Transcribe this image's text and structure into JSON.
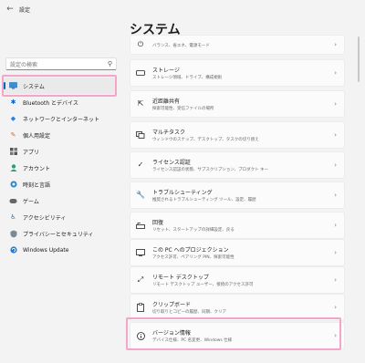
{
  "app": {
    "title": "設定",
    "page_title": "システム"
  },
  "search": {
    "placeholder": "設定の検索"
  },
  "colors": {
    "accent": "#0067c0",
    "highlight": "#f4a6c8"
  },
  "sidebar": {
    "items": [
      {
        "label": "システム",
        "icon": "monitor-icon",
        "selected": true
      },
      {
        "label": "Bluetooth とデバイス",
        "icon": "bluetooth-icon"
      },
      {
        "label": "ネットワークとインターネット",
        "icon": "wifi-icon"
      },
      {
        "label": "個人用設定",
        "icon": "brush-icon"
      },
      {
        "label": "アプリ",
        "icon": "apps-icon"
      },
      {
        "label": "アカウント",
        "icon": "account-icon"
      },
      {
        "label": "時刻と言語",
        "icon": "globe-clock-icon"
      },
      {
        "label": "ゲーム",
        "icon": "gamepad-icon"
      },
      {
        "label": "アクセシビリティ",
        "icon": "accessibility-icon"
      },
      {
        "label": "プライバシーとセキュリティ",
        "icon": "shield-icon"
      },
      {
        "label": "Windows Update",
        "icon": "update-icon"
      }
    ]
  },
  "cards": [
    {
      "title": "",
      "desc": "バランス、省エネ、電源モード",
      "icon": "power-icon"
    },
    {
      "title": "ストレージ",
      "desc": "ストレージ領域、ドライブ、構成規則",
      "icon": "storage-icon"
    },
    {
      "title": "近距離共有",
      "desc": "探索可能性、受信ファイルの場所",
      "icon": "nearby-share-icon"
    },
    {
      "title": "マルチタスク",
      "desc": "ウィンドウのスナップ、デスクトップ、タスクの切り替え",
      "icon": "multitask-icon"
    },
    {
      "title": "ライセンス認証",
      "desc": "ライセンス認証の状態、サブスクリプション、プロダクト キー",
      "icon": "activation-icon"
    },
    {
      "title": "トラブルシューティング",
      "desc": "推奨されるトラブルシューティング ツール、設定、履歴",
      "icon": "wrench-icon"
    },
    {
      "title": "回復",
      "desc": "リセット、スタートアップの詳細設定、戻る",
      "icon": "recovery-icon"
    },
    {
      "title": "この PC へのプロジェクション",
      "desc": "アクセス許可、ペアリング PIN、探索可能性",
      "icon": "projection-icon"
    },
    {
      "title": "リモート デスクトップ",
      "desc": "リモート デスクトップ ユーザー、接続のアクセス許可",
      "icon": "remote-desktop-icon"
    },
    {
      "title": "クリップボード",
      "desc": "切り取りとコピーの履歴、同期、クリア",
      "icon": "clipboard-icon"
    },
    {
      "title": "バージョン情報",
      "desc": "デバイス仕様、PC 名変更、Windows 仕様",
      "icon": "info-icon"
    }
  ]
}
